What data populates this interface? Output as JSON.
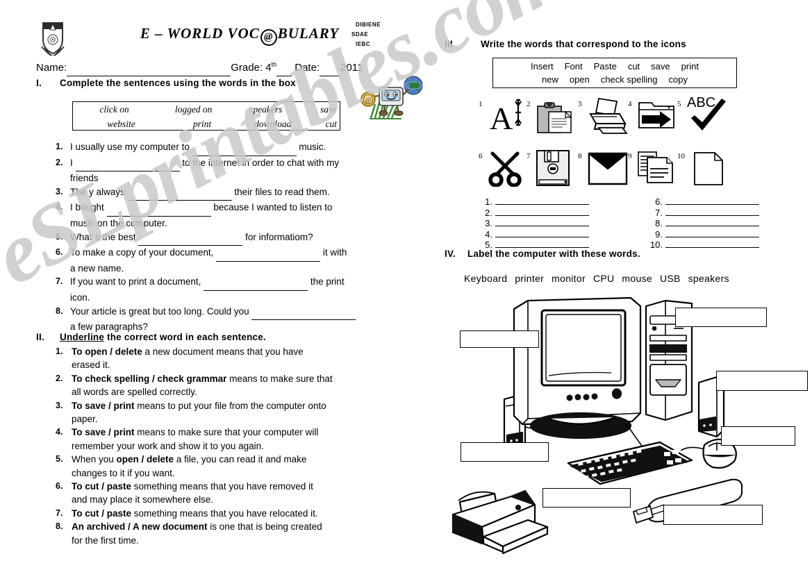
{
  "header": {
    "title_part1": "E – WORLD VOC",
    "title_at": "@",
    "title_part2": "BULARY",
    "org_lines": [
      "DIBIENE",
      "SDAE",
      "IEBC"
    ],
    "name_label": "Name:",
    "grade_label": "Grade:",
    "grade_value": "4",
    "grade_sup": "th",
    "date_label": "Date:",
    "year": "2011",
    "crest_alt": "school-crest"
  },
  "watermark": "eSLprintables.com",
  "section1": {
    "number": "I.",
    "heading": "Complete the sentences using the words in the box",
    "wordbox": {
      "row1": [
        "click on",
        "logged on",
        "speakers",
        "save"
      ],
      "row2": [
        "website",
        "print",
        "download",
        "cut"
      ]
    },
    "items": [
      {
        "n": "1.",
        "pre": "I usually use my computer to",
        "blank": 150,
        "post": "music."
      },
      {
        "n": "2.",
        "pre": "I",
        "blank": 150,
        "post": "to the internet in order to chat with my",
        "line2": "friends"
      },
      {
        "n": "3.",
        "pre": "The y always",
        "blank": 150,
        "post": "their files to read them."
      },
      {
        "n": "4.",
        "pre": "I bought",
        "blank": 150,
        "post": "because I wanted to listen to",
        "line2": "music on the computer."
      },
      {
        "n": "5.",
        "pre": "What´s the best",
        "blank": 150,
        "post": "for informatiom?"
      },
      {
        "n": "6.",
        "pre": "To make a copy of your document,",
        "blank": 150,
        "post": "it with",
        "line2": "a new name."
      },
      {
        "n": "7.",
        "pre": "If you want to print a document,",
        "blank": 150,
        "post": "the print",
        "line2": "icon."
      },
      {
        "n": "8.",
        "pre": "Your article  is great but  too long. Could you",
        "blank": 150,
        "post": "",
        "line2": "a few paragraphs?"
      }
    ]
  },
  "section2": {
    "number": "II.",
    "heading_underlined": "Underline",
    "heading_rest": " the correct word in each sentence.",
    "items": [
      {
        "n": "1.",
        "bold1": "To open / delete",
        "rest": " a new document means that you have",
        "line2": "erased it."
      },
      {
        "n": "2.",
        "bold1": "To check spelling / check grammar",
        "rest": " means to make sure that",
        "line2": "all words are spelled correctly."
      },
      {
        "n": "3.",
        "bold1": " To save / print",
        "rest": " means to put your file from the computer onto",
        "line2": "paper."
      },
      {
        "n": "4.",
        "bold1": "To save / print",
        "rest": " means to make sure that your computer will",
        "line2": "remember your work and show it to you again."
      },
      {
        "n": "5.",
        "pre": "When you ",
        "bold1": "open / delete",
        "rest": " a file, you can read it and make",
        "line2": "changes to it if you want."
      },
      {
        "n": "6.",
        "bold1": " To cut / paste",
        "rest": " something means that you have removed it",
        "line2": "and may place it somewhere else."
      },
      {
        "n": "7.",
        "bold1": " To cut / paste",
        "rest": " something means that you have relocated it.",
        "line2": ""
      },
      {
        "n": "8.",
        "bold1": " An archived  / A new document",
        "rest": " is one that is being created",
        "line2": "for the first time."
      }
    ]
  },
  "section3": {
    "number": "III.",
    "heading": "Write the words that correspond to the icons",
    "wordbox": {
      "row1": [
        "Insert",
        "Font",
        "Paste",
        "cut",
        "save",
        "print"
      ],
      "row2": [
        "new",
        "open",
        "check spelling",
        "copy"
      ]
    },
    "icons": [
      {
        "num": "1",
        "name": "font-letter-a-icon"
      },
      {
        "num": "2",
        "name": "clipboard-paste-icon"
      },
      {
        "num": "3",
        "name": "printer-icon"
      },
      {
        "num": "4",
        "name": "folder-open-icon"
      },
      {
        "num": "5",
        "name": "abc-check-spelling-icon",
        "caption": "ABC"
      },
      {
        "num": "6",
        "name": "scissors-cut-icon"
      },
      {
        "num": "7",
        "name": "floppy-disk-save-icon"
      },
      {
        "num": "8",
        "name": "envelope-insert-icon"
      },
      {
        "num": "9",
        "name": "copy-documents-icon"
      },
      {
        "num": "10",
        "name": "blank-page-new-icon"
      }
    ],
    "answer_labels_left": [
      "1.",
      "2.",
      "3.",
      "4.",
      "5."
    ],
    "answer_labels_right": [
      "6.",
      "7.",
      "8.",
      "9.",
      "10."
    ]
  },
  "section4": {
    "number": "IV.",
    "heading": "Label the computer with these words.",
    "words": [
      "Keyboard",
      "printer",
      "monitor",
      "CPU",
      "mouse",
      "USB",
      "speakers"
    ],
    "label_boxes": [
      {
        "name": "label-box-monitor"
      },
      {
        "name": "label-box-cpu"
      },
      {
        "name": "label-box-speakers"
      },
      {
        "name": "label-box-mouse"
      },
      {
        "name": "label-box-keyboard"
      },
      {
        "name": "label-box-printer"
      },
      {
        "name": "label-box-usb"
      }
    ]
  },
  "colors": {
    "ink": "#000000",
    "watermark": "#c9c9c9",
    "paper": "#ffffff"
  }
}
